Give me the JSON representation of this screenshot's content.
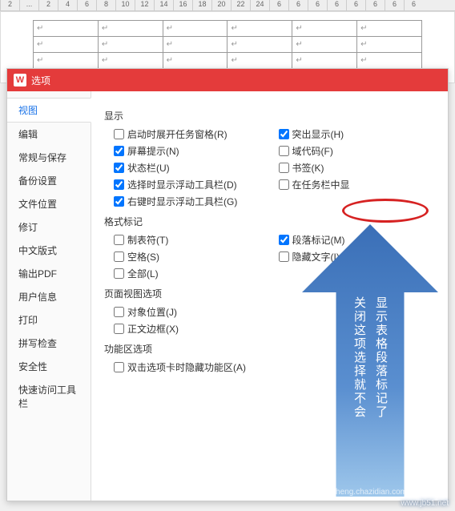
{
  "ruler": [
    "2",
    "...",
    "2",
    "4",
    "6",
    "8",
    "10",
    "12",
    "14",
    "16",
    "18",
    "20",
    "22",
    "24",
    "6",
    "6",
    "6",
    "6",
    "6",
    "6",
    "6",
    "6"
  ],
  "dialog": {
    "logo": "W",
    "title": "选项"
  },
  "sidebar": {
    "items": [
      {
        "label": "视图",
        "active": true
      },
      {
        "label": "编辑"
      },
      {
        "label": "常规与保存"
      },
      {
        "label": "备份设置"
      },
      {
        "label": "文件位置"
      },
      {
        "label": "修订"
      },
      {
        "label": "中文版式"
      },
      {
        "label": "输出PDF"
      },
      {
        "label": "用户信息"
      },
      {
        "label": "打印"
      },
      {
        "label": "拼写检查"
      },
      {
        "label": "安全性"
      },
      {
        "label": "快速访问工具栏"
      }
    ]
  },
  "sections": {
    "display": {
      "title": "显示",
      "items": [
        {
          "label": "启动时展开任务窗格(R)",
          "checked": false
        },
        {
          "label": "突出显示(H)",
          "checked": true
        },
        {
          "label": "屏幕提示(N)",
          "checked": true
        },
        {
          "label": "域代码(F)",
          "checked": false
        },
        {
          "label": "状态栏(U)",
          "checked": true
        },
        {
          "label": "书签(K)",
          "checked": false
        },
        {
          "label": "选择时显示浮动工具栏(D)",
          "checked": true
        },
        {
          "label": "在任务栏中显",
          "checked": false
        },
        {
          "label": "右键时显示浮动工具栏(G)",
          "checked": true
        }
      ]
    },
    "format": {
      "title": "格式标记",
      "items": [
        {
          "label": "制表符(T)",
          "checked": false
        },
        {
          "label": "段落标记(M)",
          "checked": true,
          "highlight": true
        },
        {
          "label": "空格(S)",
          "checked": false
        },
        {
          "label": "隐藏文字(I)",
          "checked": false
        },
        {
          "label": "全部(L)",
          "checked": false
        }
      ]
    },
    "page_view": {
      "title": "页面视图选项",
      "items": [
        {
          "label": "对象位置(J)",
          "checked": false
        },
        {
          "label": "正文边框(X)",
          "checked": false
        }
      ]
    },
    "func": {
      "title": "功能区选项",
      "items": [
        {
          "label": "双击选项卡时隐藏功能区(A)",
          "checked": false
        }
      ]
    }
  },
  "annotation": {
    "line1": "关闭这项选择就不会",
    "line2": "显示表格段落标记了"
  },
  "watermark": {
    "site1": "www.jb51.net",
    "site2": "jiaocheng.chazidian.com"
  },
  "cell_mark": "↵"
}
